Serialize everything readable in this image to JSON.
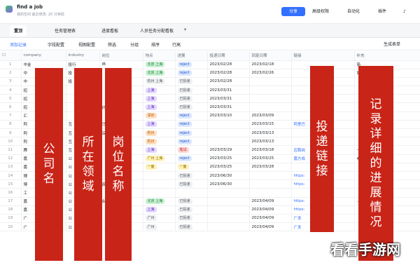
{
  "app": {
    "title": "find a job",
    "subtitle": "我的空间  最近修改: 20 分钟前",
    "share": "分享",
    "perm": "高级权限",
    "auto": "自动化",
    "plugin": "插件"
  },
  "tabs": [
    "置顶",
    "任务管理表",
    "进度看板",
    "人员任务分配看板",
    "+"
  ],
  "toolbar": {
    "add": "添加记录",
    "fields": "字段配置",
    "view": "视图配置",
    "filter": "筛选",
    "group": "分组",
    "sort": "排序",
    "rowheight": "行高",
    "generate": "生成表单"
  },
  "columns": [
    "company",
    "industry",
    "岗位",
    "地点",
    "进展",
    "投递日期",
    "回复日期",
    "链接",
    "补充"
  ],
  "rows": [
    {
      "n": "1",
      "company": "中金",
      "industry": "投行",
      "job": "IB",
      "loc": "北京 上海",
      "loc_c": "green",
      "prog": "reject",
      "prog_c": "blue",
      "d1": "2023/02/28",
      "d2": "2023/02/18",
      "link": "",
      "note": "简"
    },
    {
      "n": "2",
      "company": "中",
      "industry": "投",
      "job": "",
      "loc": "北京 上海",
      "loc_c": "green",
      "prog": "reject",
      "prog_c": "blue",
      "d1": "2023/02/28",
      "d2": "2023/02/26",
      "link": "",
      "note": "简"
    },
    {
      "n": "3",
      "company": "中",
      "industry": "投",
      "job": "",
      "loc": "杭州 上海",
      "loc_c": "gray",
      "prog": "已投递",
      "prog_c": "gray",
      "d1": "2023/02/28",
      "d2": "",
      "link": "",
      "note": ""
    },
    {
      "n": "4",
      "company": "招",
      "industry": "",
      "job": "",
      "loc": "上海",
      "loc_c": "purple",
      "prog": "已投递",
      "prog_c": "gray",
      "d1": "2023/03/31",
      "d2": "",
      "link": "",
      "note": ""
    },
    {
      "n": "5",
      "company": "招",
      "industry": "",
      "job": "",
      "loc": "上海",
      "loc_c": "purple",
      "prog": "已投递",
      "prog_c": "gray",
      "d1": "2023/03/31",
      "d2": "",
      "link": "",
      "note": ""
    },
    {
      "n": "6",
      "company": "招",
      "industry": "",
      "job": "(投行)",
      "loc": "上海",
      "loc_c": "purple",
      "prog": "已投递",
      "prog_c": "gray",
      "d1": "2023/03/31",
      "d2": "",
      "link": "",
      "note": ""
    },
    {
      "n": "7",
      "company": "汇",
      "industry": "",
      "job": "",
      "loc": "深圳",
      "loc_c": "orange",
      "prog": "reject",
      "prog_c": "blue",
      "d1": "2023/03/10",
      "d2": "2023/03/09",
      "link": "",
      "note": ""
    },
    {
      "n": "8",
      "company": "阿",
      "industry": "互",
      "job": "马",
      "loc": "上海",
      "loc_c": "purple",
      "prog": "reject",
      "prog_c": "blue",
      "d1": "",
      "d2": "2023/03/15",
      "link": "阿里巴",
      "note": ""
    },
    {
      "n": "9",
      "company": "阿",
      "industry": "互",
      "job": "深营",
      "loc": "杭州",
      "loc_c": "orange",
      "prog": "reject",
      "prog_c": "blue",
      "d1": "",
      "d2": "2023/03/13",
      "link": "",
      "note": ""
    },
    {
      "n": "10",
      "company": "阿",
      "industry": "互",
      "job": "",
      "loc": "杭州",
      "loc_c": "orange",
      "prog": "reject",
      "prog_c": "blue",
      "d1": "",
      "d2": "2023/03/13",
      "link": "",
      "note": ""
    },
    {
      "n": "11",
      "company": "腾",
      "industry": "互",
      "job": "",
      "loc": "上海",
      "loc_c": "purple",
      "prog": "笔试",
      "prog_c": "red",
      "d1": "2023/03/29",
      "d2": "2023/03/18",
      "link": "应聘岗",
      "note": "—"
    },
    {
      "n": "12",
      "company": "嘉",
      "industry": "公",
      "job": "",
      "loc": "广州 上海",
      "loc_c": "yellow",
      "prog": "reject",
      "prog_c": "blue",
      "d1": "2023/03/25",
      "d2": "2023/03/25",
      "link": "嘉方成",
      "note": "4.4 类"
    },
    {
      "n": "13",
      "company": "嘉",
      "industry": "公",
      "job": "",
      "loc": "一面",
      "loc_c": "yellow",
      "prog": "一面",
      "prog_c": "yellow",
      "d1": "2023/03/25",
      "d2": "2023/03/28",
      "link": "",
      "note": ""
    },
    {
      "n": "14",
      "company": "博",
      "industry": "公",
      "job": "",
      "loc": "",
      "loc_c": "",
      "prog": "已投递",
      "prog_c": "gray",
      "d1": "2023/06/30",
      "d2": "",
      "link": "https:",
      "note": "【 "
    },
    {
      "n": "15",
      "company": "博",
      "industry": "公",
      "job": "资投资部",
      "loc": "",
      "loc_c": "",
      "prog": "已投递",
      "prog_c": "gray",
      "d1": "2023/06/30",
      "d2": "",
      "link": "https:",
      "note": "【 "
    },
    {
      "n": "16",
      "company": "工",
      "industry": "公",
      "job": "",
      "loc": "",
      "loc_c": "",
      "prog": "",
      "prog_c": "",
      "d1": "",
      "d2": "",
      "link": "",
      "note": ""
    },
    {
      "n": "17",
      "company": "嘉",
      "industry": "公",
      "job": "业研究",
      "loc": "北京 上海",
      "loc_c": "green",
      "prog": "已投递",
      "prog_c": "gray",
      "d1": "",
      "d2": "2023/04/09",
      "link": "https:",
      "note": "-关于"
    },
    {
      "n": "18",
      "company": "嘉",
      "industry": "公",
      "job": "",
      "loc": "上海",
      "loc_c": "purple",
      "prog": "已投递",
      "prog_c": "gray",
      "d1": "",
      "d2": "2023/04/09",
      "link": "https:",
      "note": ""
    },
    {
      "n": "19",
      "company": "广",
      "industry": "公",
      "job": "",
      "loc": "广州",
      "loc_c": "gray",
      "prog": "已投递",
      "prog_c": "gray",
      "d1": "",
      "d2": "2023/04/09",
      "link": "广发",
      "note": ""
    },
    {
      "n": "20",
      "company": "广",
      "industry": "公",
      "job": "",
      "loc": "广州",
      "loc_c": "gray",
      "prog": "已投递",
      "prog_c": "gray",
      "d1": "",
      "d2": "2023/04/09",
      "link": "广发",
      "note": ""
    }
  ],
  "overlays": {
    "company": "公司名",
    "industry": "所在领域",
    "job": "岗位名称",
    "link": "投递链接",
    "note": "记录详细的进展情况"
  },
  "watermark": "看看手游网"
}
